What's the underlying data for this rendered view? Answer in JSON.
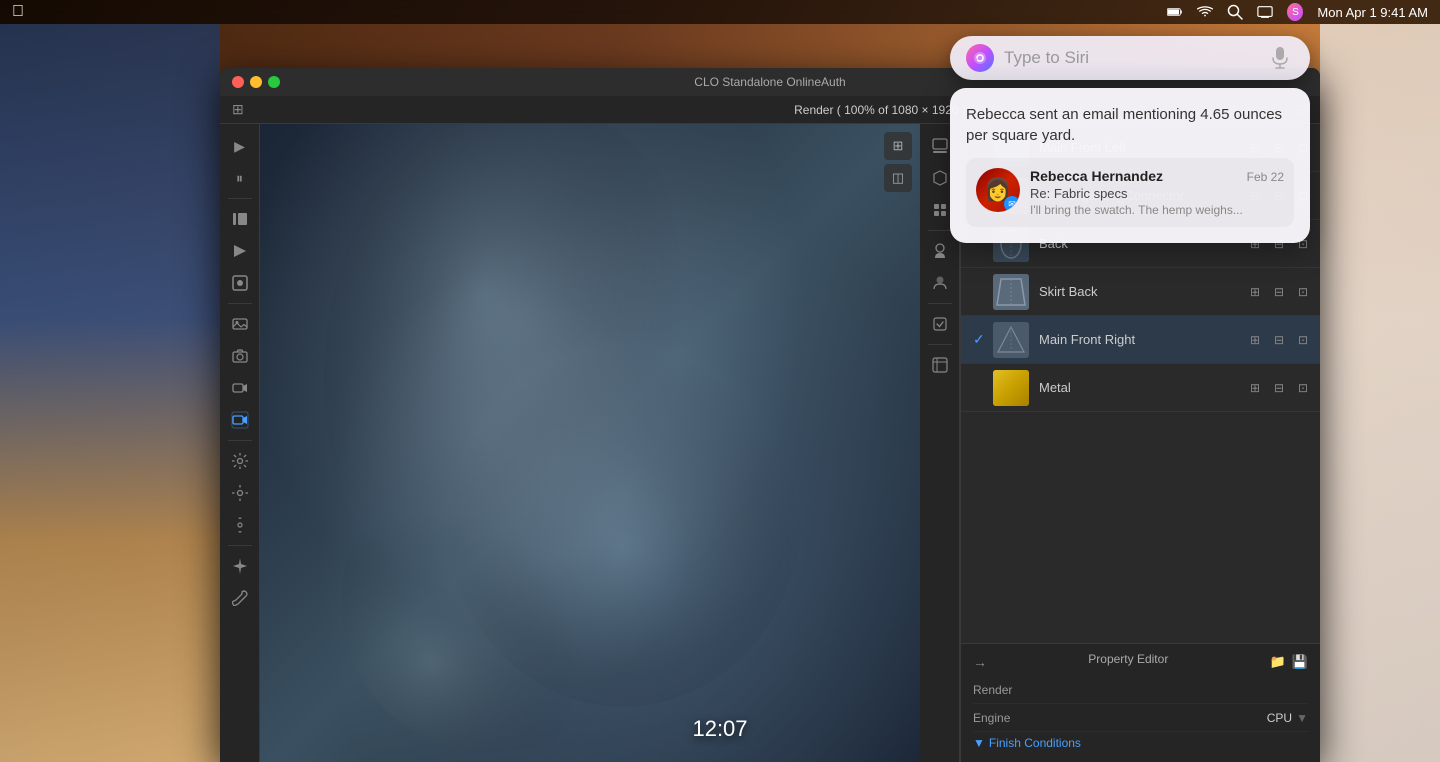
{
  "menubar": {
    "datetime": "Mon Apr 1  9:41 AM",
    "battery_icon": "battery",
    "wifi_icon": "wifi",
    "search_icon": "search",
    "screen_icon": "screen-mirroring",
    "user_icon": "user-circle"
  },
  "window": {
    "title": "CLO Standalone OnlineAuth",
    "render_title": "Render ( 100% of 1080 × 1920 )"
  },
  "fabric_list": {
    "items": [
      {
        "id": "main-front-left",
        "name": "Main Front Left",
        "thumbnail_class": "thumb-main-front-left",
        "checked": false
      },
      {
        "id": "silk-organza",
        "name": "Silk_Organza_Connector",
        "thumbnail_class": "thumb-silk-organza",
        "checked": false
      },
      {
        "id": "back",
        "name": "Back",
        "thumbnail_class": "thumb-back",
        "checked": false
      },
      {
        "id": "skirt-back",
        "name": "Skirt Back",
        "thumbnail_class": "thumb-skirt-back",
        "checked": false
      },
      {
        "id": "main-front-right",
        "name": "Main Front Right",
        "thumbnail_class": "thumb-main-front-right",
        "checked": true
      },
      {
        "id": "metal",
        "name": "Metal",
        "thumbnail_class": "thumb-metal",
        "checked": false
      }
    ],
    "action_add": "+",
    "action_grid": "⊞",
    "action_link": "🔗"
  },
  "property_editor": {
    "title": "Property Editor",
    "render_label": "Render",
    "engine_label": "Engine",
    "engine_value": "CPU",
    "finish_conditions_label": "Finish Conditions",
    "icons": {
      "folder": "📁",
      "save": "💾",
      "chevron_down": "▼"
    }
  },
  "siri": {
    "input_placeholder": "Type to Siri",
    "notification_text": "Rebecca sent an email mentioning 4.65 ounces per square yard.",
    "sender_name": "Rebecca Hernandez",
    "email_subject": "Re: Fabric specs",
    "email_preview": "I'll bring the swatch. The hemp weighs...",
    "email_date": "Feb 22",
    "mic_icon": "🎙"
  },
  "clock": {
    "time": "12:07"
  },
  "toolbar_icons": {
    "icons": [
      "▶",
      "⏸",
      "⏹",
      "🎬",
      "🖼",
      "📷",
      "🎥",
      "📹",
      "⚙",
      "⚙",
      "⚙",
      "✦",
      "🔧"
    ]
  }
}
